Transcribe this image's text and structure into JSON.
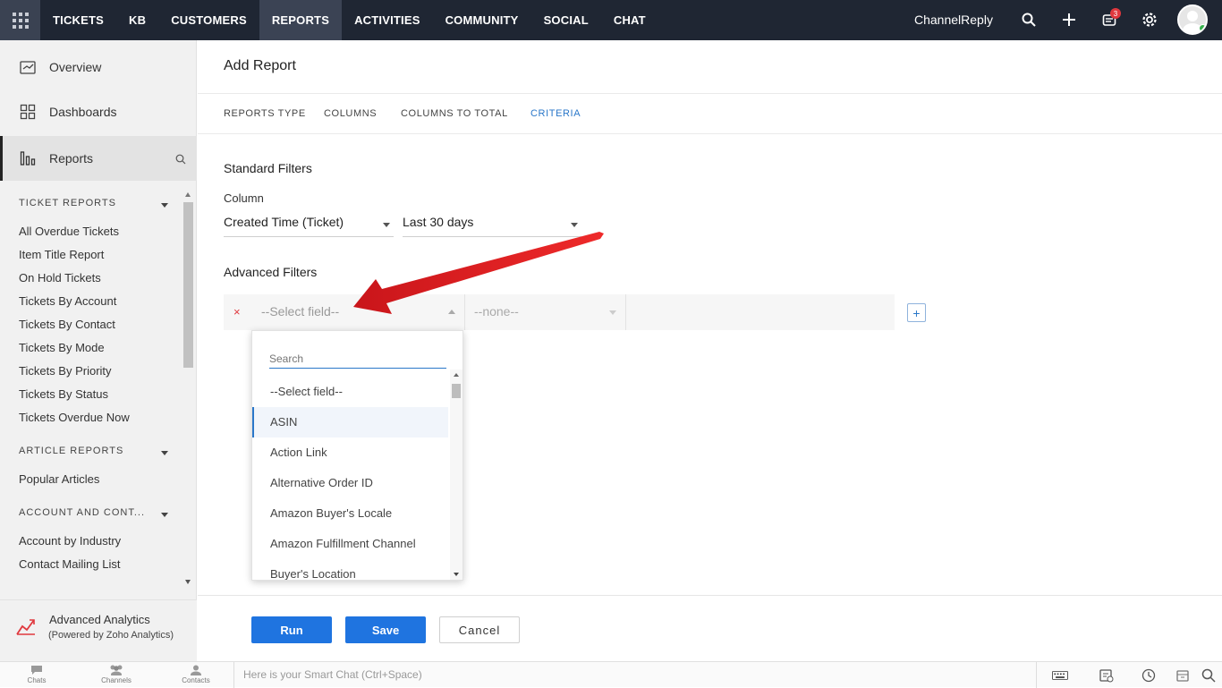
{
  "topbar": {
    "nav": [
      "TICKETS",
      "KB",
      "CUSTOMERS",
      "REPORTS",
      "ACTIVITIES",
      "COMMUNITY",
      "SOCIAL",
      "CHAT"
    ],
    "active_nav": "REPORTS",
    "brand": "ChannelReply",
    "notification_count": "3"
  },
  "sidebar": {
    "main_nav": [
      {
        "label": "Overview",
        "icon": "overview-icon"
      },
      {
        "label": "Dashboards",
        "icon": "dashboards-icon"
      },
      {
        "label": "Reports",
        "icon": "reports-icon",
        "active": true
      }
    ],
    "sections": [
      {
        "title": "TICKET REPORTS",
        "items": [
          "All Overdue Tickets",
          "Item Title Report",
          "On Hold Tickets",
          "Tickets By Account",
          "Tickets By Contact",
          "Tickets By Mode",
          "Tickets By Priority",
          "Tickets By Status",
          "Tickets Overdue Now"
        ]
      },
      {
        "title": "ARTICLE REPORTS",
        "items": [
          "Popular Articles"
        ]
      },
      {
        "title": "ACCOUNT AND CONT...",
        "items": [
          "Account by Industry",
          "Contact Mailing List"
        ]
      }
    ],
    "analytics": {
      "title": "Advanced Analytics",
      "subtitle": "(Powered by Zoho Analytics)"
    }
  },
  "main": {
    "title": "Add Report",
    "tabs": [
      "REPORTS TYPE",
      "COLUMNS",
      "COLUMNS TO TOTAL",
      "CRITERIA"
    ],
    "active_tab": "CRITERIA",
    "standard_filters": {
      "heading": "Standard Filters",
      "column_label": "Column",
      "column_value": "Created Time (Ticket)",
      "range_value": "Last 30 days"
    },
    "advanced_filters": {
      "heading": "Advanced Filters",
      "remove": "×",
      "field_placeholder": "--Select field--",
      "operator_placeholder": "--none--",
      "add": "+"
    },
    "dropdown": {
      "search_placeholder": "Search",
      "options": [
        "--Select field--",
        "ASIN",
        "Action Link",
        "Alternative Order ID",
        "Amazon Buyer's Locale",
        "Amazon Fulfillment Channel",
        "Buyer's Location"
      ],
      "highlighted": "ASIN"
    },
    "buttons": {
      "run": "Run",
      "save": "Save",
      "cancel": "Cancel"
    }
  },
  "bottombar": {
    "items": [
      "Chats",
      "Channels",
      "Contacts"
    ],
    "smart_chat_placeholder": "Here is your Smart Chat (Ctrl+Space)"
  },
  "colors": {
    "topbar": "#1f2633",
    "accent": "#2a77c9",
    "primary_button": "#1f74e0",
    "annotation_arrow": "#e01b1b"
  }
}
